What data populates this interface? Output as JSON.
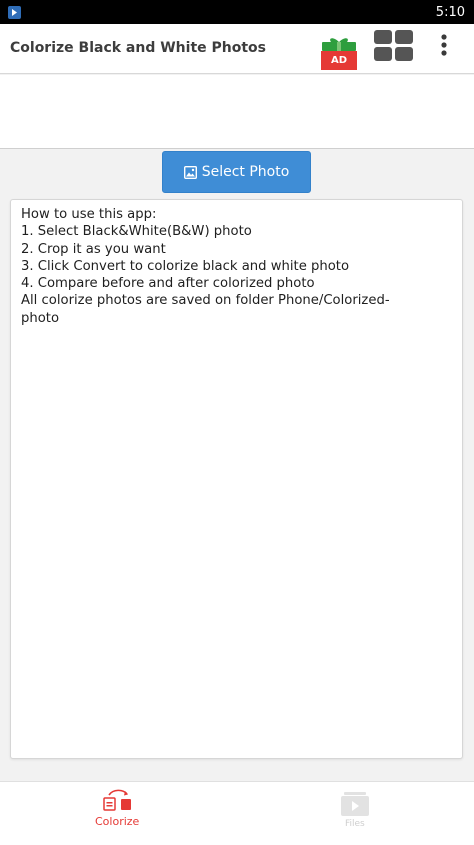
{
  "status_bar": {
    "time": "5:10",
    "app_icon": "app-notification-icon"
  },
  "app_bar": {
    "title": "Colorize Black and White Photos",
    "ad_badge": "AD",
    "ad_icon": "gift-icon",
    "grid_icon": "grid-apps-icon",
    "menu_icon": "more-vert-icon"
  },
  "main": {
    "select_photo_label": "Select Photo",
    "select_photo_icon": "image-icon",
    "instructions": [
      "How to use this app:",
      "1. Select Black&White(B&W) photo",
      "2. Crop it as you want",
      "3. Click Convert to colorize black and white photo",
      "4. Compare before and after colorized photo",
      "All colorize photos are saved on folder Phone/Colorized-",
      "photo"
    ]
  },
  "bottom_nav": {
    "items": [
      {
        "label": "Colorize",
        "icon": "colorize-icon",
        "active": true
      },
      {
        "label": "Files",
        "icon": "video-files-icon",
        "active": false
      }
    ]
  },
  "colors": {
    "accent_blue": "#3f8dd6",
    "active_red": "#e53935",
    "ad_red": "#e53935",
    "gift_green": "#2e9e3e",
    "status_bar": "#000000"
  }
}
